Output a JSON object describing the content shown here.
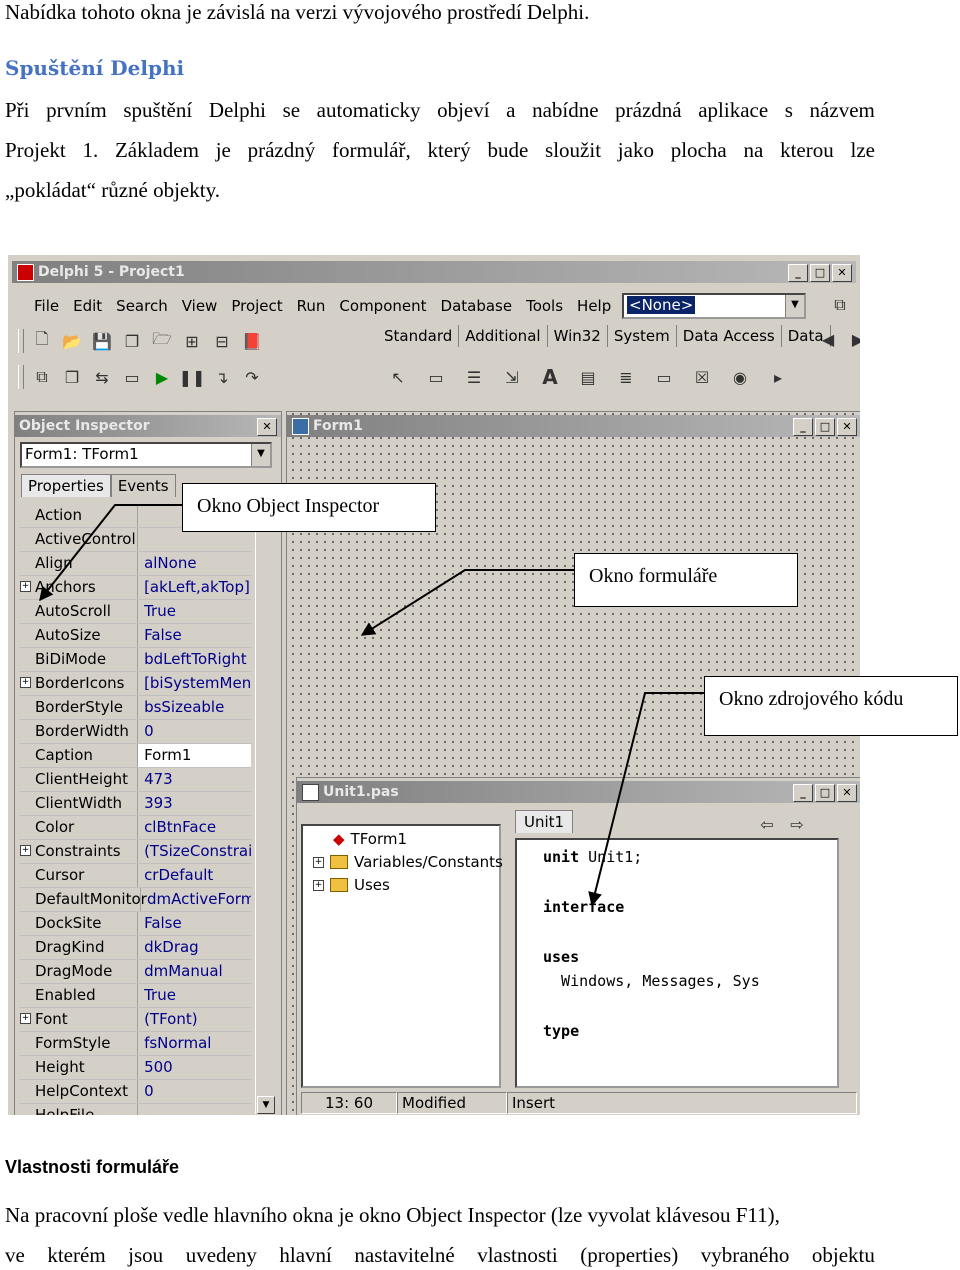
{
  "text": {
    "intro_line": "Nabídka tohoto okna je závislá na verzi vývojového prostředí Delphi.",
    "section1_heading": "Spuštění Delphi",
    "para1_line1": [
      "Při",
      "prvním",
      "spuštění",
      "Delphi",
      "se",
      "automaticky",
      "objeví",
      "a",
      "nabídne",
      "prázdná",
      "aplikace",
      "s",
      "názvem"
    ],
    "para1_line2": [
      "Projekt",
      "1.",
      "Základem",
      "je",
      "prázdný",
      "formulář,",
      "který",
      "bude",
      "sloužit",
      "jako",
      "plocha",
      "na",
      "kterou",
      "lze"
    ],
    "para1_line3": "„pokládat“ různé objekty.",
    "section2_heading": "Vlastnosti formuláře",
    "para2_line1": "Na pracovní ploše vedle hlavního okna je okno Object Inspector (lze vyvolat klávesou F11),",
    "para2_line2": [
      "ve",
      "kterém",
      "jsou",
      "uvedeny",
      "hlavní",
      "nastavitelné",
      "vlastnosti",
      "(properties)",
      "vybraného",
      "objektu"
    ]
  },
  "callouts": {
    "object_inspector": "Okno Object Inspector",
    "form": "Okno formuláře",
    "source": "Okno zdrojového kódu"
  },
  "ide": {
    "main_title": "Delphi 5 - Project1",
    "menu": [
      "File",
      "Edit",
      "Search",
      "View",
      "Project",
      "Run",
      "Component",
      "Database",
      "Tools",
      "Help"
    ],
    "config_combo": "<None>",
    "palette_tabs": [
      "Standard",
      "Additional",
      "Win32",
      "System",
      "Data Access",
      "Data"
    ],
    "oi_title": "Object Inspector",
    "oi_combo": "Form1: TForm1",
    "oi_tabs": [
      "Properties",
      "Events"
    ],
    "properties": [
      {
        "name": "Action",
        "value": "",
        "plus": false
      },
      {
        "name": "ActiveControl",
        "value": "",
        "plus": false
      },
      {
        "name": "Align",
        "value": "alNone",
        "plus": false
      },
      {
        "name": "Anchors",
        "value": "[akLeft,akTop]",
        "plus": true
      },
      {
        "name": "AutoScroll",
        "value": "True",
        "plus": false
      },
      {
        "name": "AutoSize",
        "value": "False",
        "plus": false
      },
      {
        "name": "BiDiMode",
        "value": "bdLeftToRight",
        "plus": false
      },
      {
        "name": "BorderIcons",
        "value": "[biSystemMenu,",
        "plus": true
      },
      {
        "name": "BorderStyle",
        "value": "bsSizeable",
        "plus": false
      },
      {
        "name": "BorderWidth",
        "value": "0",
        "plus": false
      },
      {
        "name": "Caption",
        "value": "Form1",
        "plus": false
      },
      {
        "name": "ClientHeight",
        "value": "473",
        "plus": false
      },
      {
        "name": "ClientWidth",
        "value": "393",
        "plus": false
      },
      {
        "name": "Color",
        "value": "clBtnFace",
        "plus": false
      },
      {
        "name": "Constraints",
        "value": "(TSizeConstrain",
        "plus": true
      },
      {
        "name": "Cursor",
        "value": "crDefault",
        "plus": false
      },
      {
        "name": "DefaultMonitor",
        "value": "dmActiveForm",
        "plus": false
      },
      {
        "name": "DockSite",
        "value": "False",
        "plus": false
      },
      {
        "name": "DragKind",
        "value": "dkDrag",
        "plus": false
      },
      {
        "name": "DragMode",
        "value": "dmManual",
        "plus": false
      },
      {
        "name": "Enabled",
        "value": "True",
        "plus": false
      },
      {
        "name": "Font",
        "value": "(TFont)",
        "plus": true
      },
      {
        "name": "FormStyle",
        "value": "fsNormal",
        "plus": false
      },
      {
        "name": "Height",
        "value": "500",
        "plus": false
      },
      {
        "name": "HelpContext",
        "value": "0",
        "plus": false
      },
      {
        "name": "HelpFile",
        "value": "",
        "plus": false
      }
    ],
    "form_title": "Form1",
    "unit_title": "Unit1.pas",
    "tree": [
      "TForm1",
      "Variables/Constants",
      "Uses"
    ],
    "editor_tab": "Unit1",
    "code": {
      "l1_kw": "unit",
      "l1_rest": " Unit1;",
      "l2_kw": "interface",
      "l3_kw": "uses",
      "l4": "  Windows, Messages, Sys",
      "l5_kw": "type"
    },
    "status": {
      "pos": "13: 60",
      "modified": "Modified",
      "mode": "Insert"
    }
  }
}
